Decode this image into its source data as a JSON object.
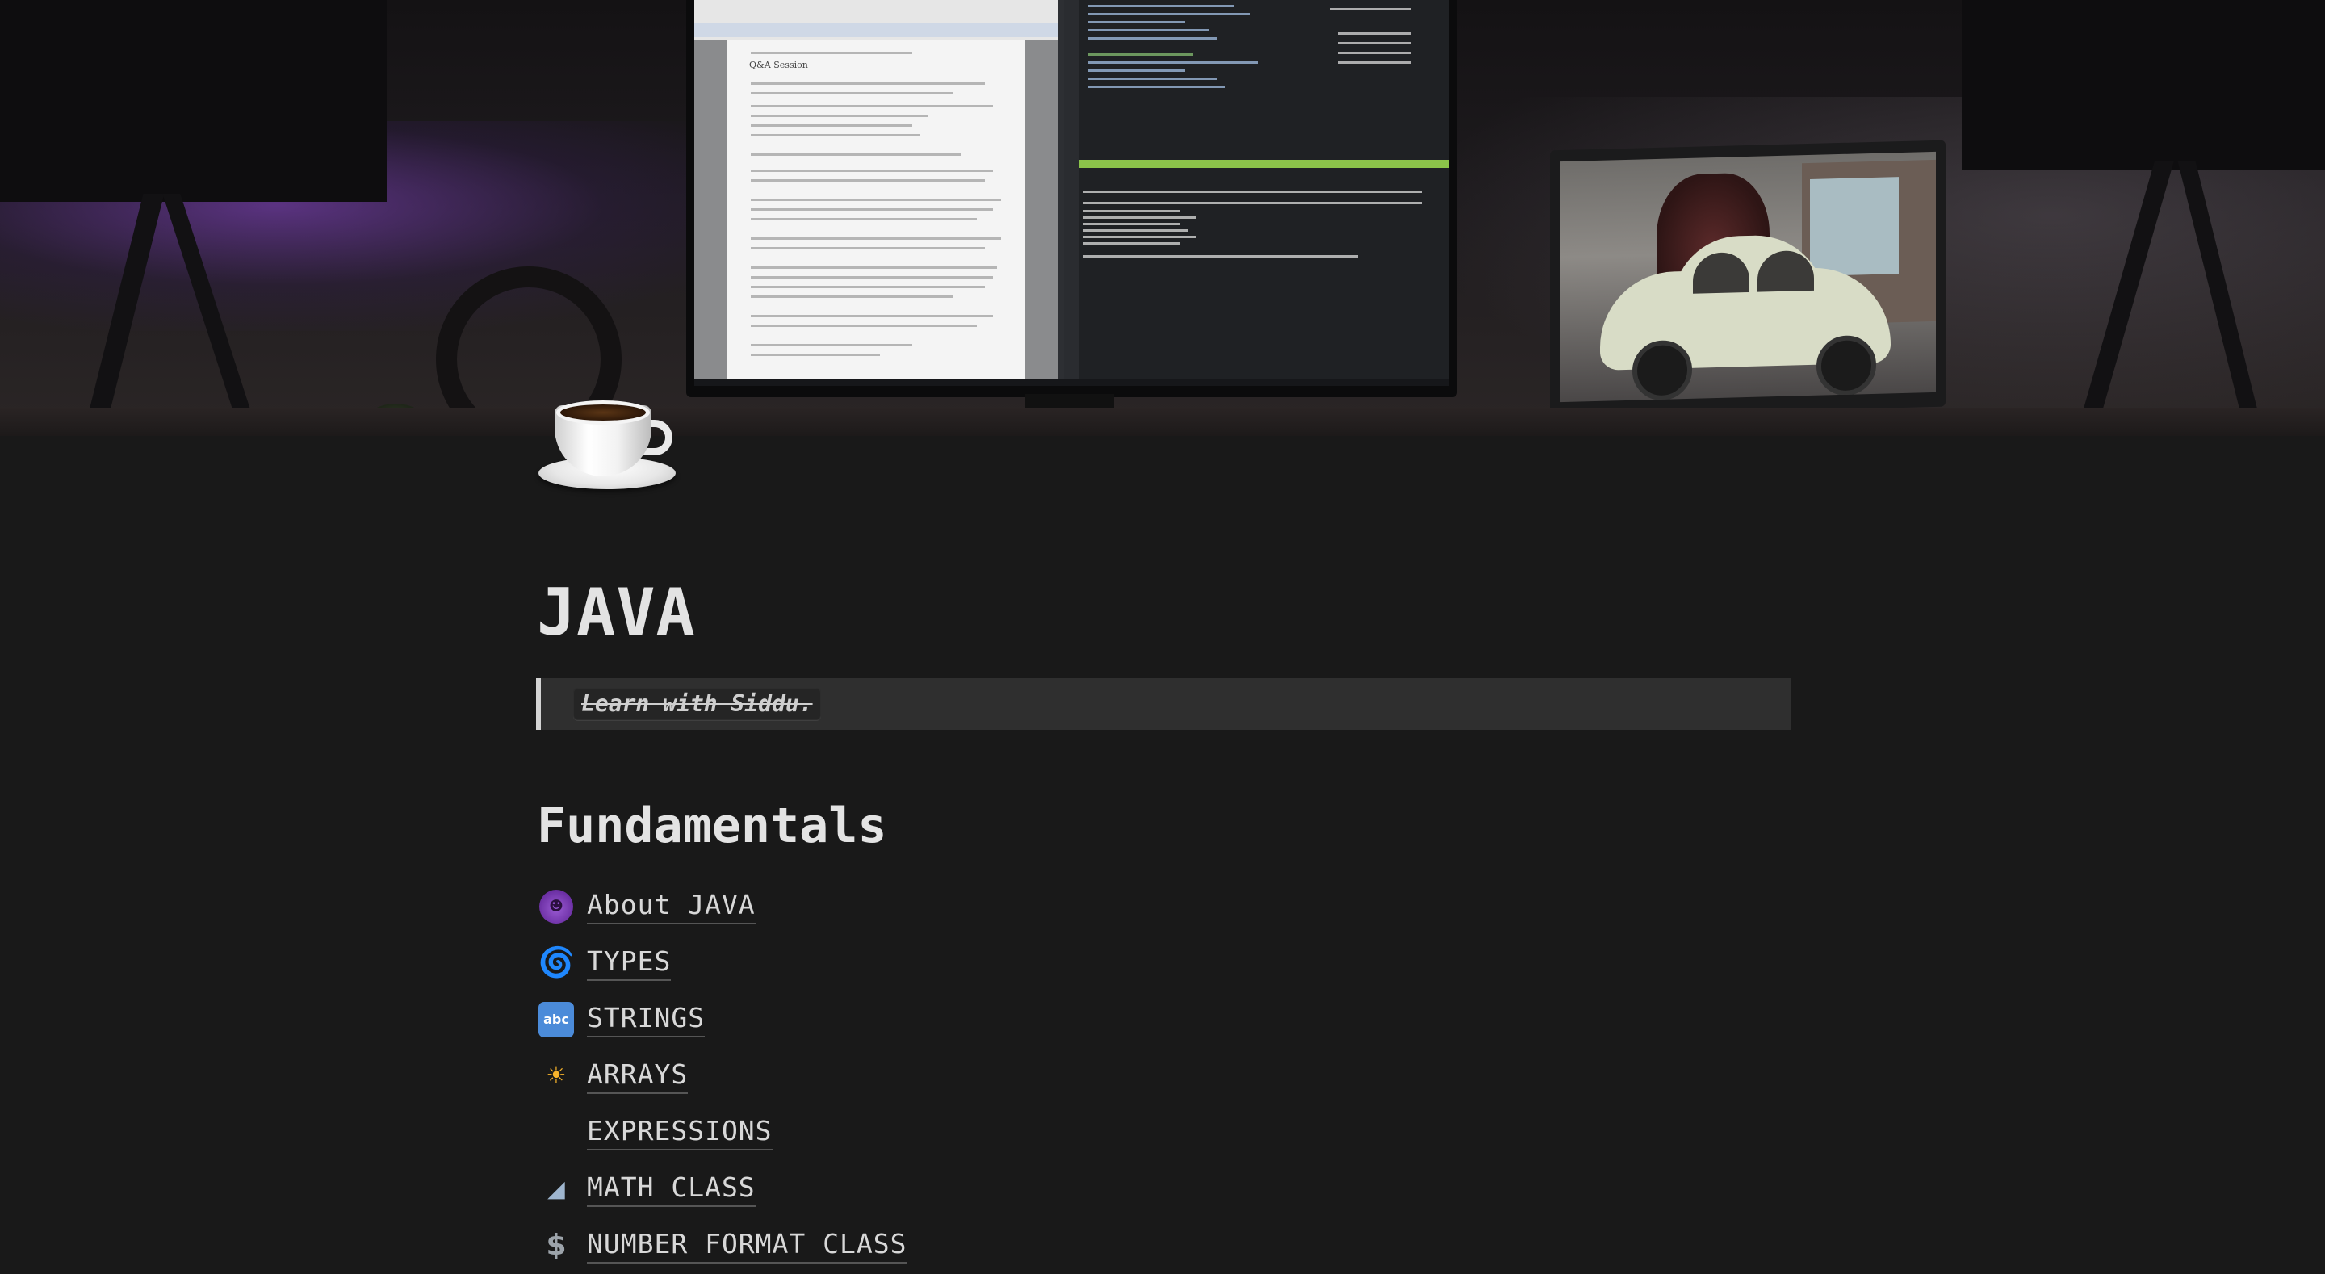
{
  "page": {
    "icon": "coffee-cup-icon",
    "title": "JAVA",
    "quote": "Learn with Siddu."
  },
  "section": {
    "heading": "Fundamentals",
    "links": [
      {
        "icon": "smiling-devil-icon",
        "glyph": "😈",
        "label": "About JAVA"
      },
      {
        "icon": "cyclone-icon",
        "glyph": "🌀",
        "label": "TYPES"
      },
      {
        "icon": "abc-icon",
        "glyph": "abc",
        "label": "STRINGS"
      },
      {
        "icon": "sun-icon",
        "glyph": "☀",
        "label": "ARRAYS"
      },
      {
        "icon": "equals-icon",
        "glyph": "",
        "label": "EXPRESSIONS"
      },
      {
        "icon": "triangular-ruler-icon",
        "glyph": "📐",
        "label": "MATH CLASS"
      },
      {
        "icon": "dollar-icon",
        "glyph": "$",
        "label": "NUMBER FORMAT CLASS"
      }
    ]
  },
  "cover": {
    "pdf_heading": "Q&A Session"
  },
  "colors": {
    "background": "#191919",
    "text": "#d4d4d4",
    "quote_background": "#2f2f2f"
  }
}
